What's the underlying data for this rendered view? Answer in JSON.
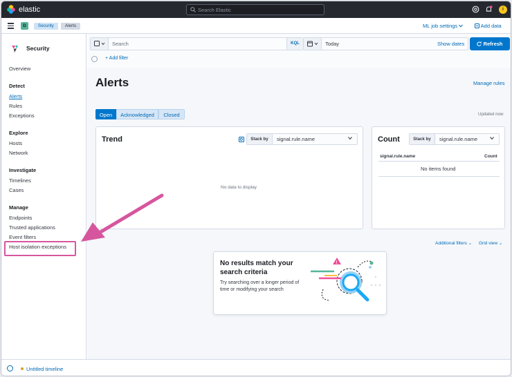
{
  "colors": {
    "accent": "#0077cc",
    "link": "#006bb8",
    "annotation": "#d6569e",
    "topbar": "#25282f"
  },
  "topbar": {
    "brand": "elastic",
    "search_placeholder": "Search Elastic",
    "avatar_initial": "i"
  },
  "subbar": {
    "space_initial": "D",
    "breadcrumbs": [
      "Security",
      "Alerts"
    ],
    "ml_job_settings": "ML job settings",
    "add_data": "Add data"
  },
  "sidebar": {
    "title": "Security",
    "overview": "Overview",
    "sections": [
      {
        "heading": "Detect",
        "items": [
          "Alerts",
          "Rules",
          "Exceptions"
        ]
      },
      {
        "heading": "Explore",
        "items": [
          "Hosts",
          "Network"
        ]
      },
      {
        "heading": "Investigate",
        "items": [
          "Timelines",
          "Cases"
        ]
      },
      {
        "heading": "Manage",
        "items": [
          "Endpoints",
          "Trusted applications",
          "Event filters",
          "Host isolation exceptions"
        ]
      }
    ]
  },
  "query": {
    "search_placeholder": "Search",
    "kql": "KQL",
    "date": "Today",
    "show_dates": "Show dates",
    "refresh": "Refresh",
    "add_filter": "+ Add filter"
  },
  "page": {
    "title": "Alerts",
    "manage_rules": "Manage rules",
    "tabs": [
      "Open",
      "Acknowledged",
      "Closed"
    ],
    "selected_tab": "Open",
    "updated": "Updated now"
  },
  "trend": {
    "title": "Trend",
    "stack_by_label": "Stack by",
    "stack_by_value": "signal.rule.name",
    "empty": "No data to display"
  },
  "count": {
    "title": "Count",
    "stack_by_label": "Stack by",
    "stack_by_value": "signal.rule.name",
    "col_name": "signal.rule.name",
    "col_count": "Count",
    "empty": "No items found"
  },
  "table_controls": {
    "additional_filters": "Additional filters",
    "grid_view": "Grid view"
  },
  "empty_state": {
    "title": "No results match your search criteria",
    "body": "Try searching over a longer period of time or modifying your search"
  },
  "timeline": {
    "name": "Untitled timeline"
  }
}
